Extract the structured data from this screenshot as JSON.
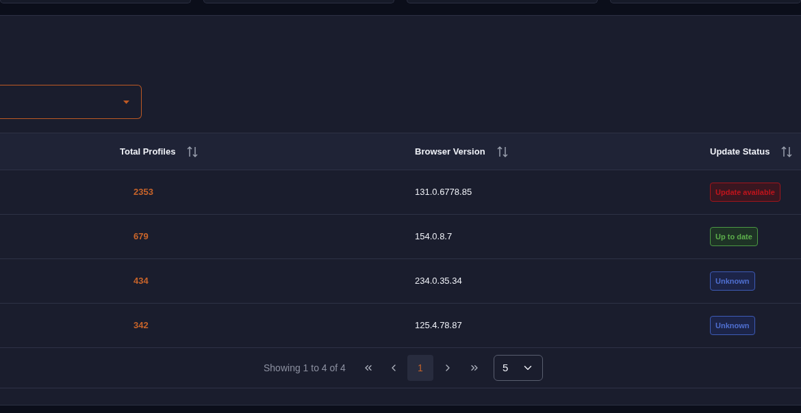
{
  "table": {
    "columns": [
      {
        "label": "Total Profiles"
      },
      {
        "label": "Browser Version"
      },
      {
        "label": "Update Status"
      }
    ],
    "rows": [
      {
        "total_profiles": "2353",
        "browser_version": "131.0.6778.85",
        "status": {
          "label": "Update available",
          "kind": "danger"
        }
      },
      {
        "total_profiles": "679",
        "browser_version": "154.0.8.7",
        "status": {
          "label": "Up to date",
          "kind": "success"
        }
      },
      {
        "total_profiles": "434",
        "browser_version": "234.0.35.34",
        "status": {
          "label": "Unknown",
          "kind": "info"
        }
      },
      {
        "total_profiles": "342",
        "browser_version": "125.4.78.87",
        "status": {
          "label": "Unknown",
          "kind": "info"
        }
      }
    ]
  },
  "pagination": {
    "summary": "Showing 1 to 4 of 4",
    "pages": [
      {
        "label": "1",
        "selected": true
      }
    ],
    "page_size": "5"
  }
}
